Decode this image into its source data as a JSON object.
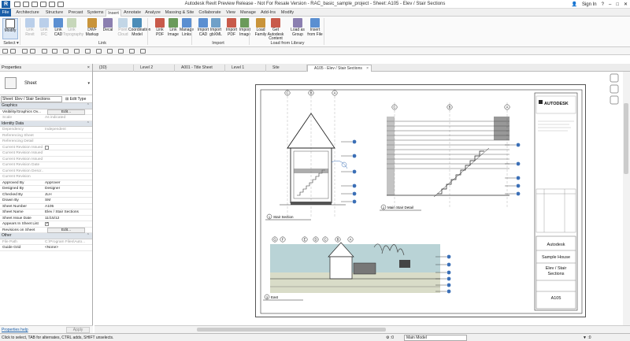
{
  "window": {
    "title": "Autodesk Revit Preview Release - Not For Resale Version - RAC_basic_sample_project - Sheet: A105 - Elev / Stair Sections",
    "sign_in": "Sign In",
    "help": "?"
  },
  "ribbon_tabs": [
    "File",
    "Architecture",
    "Structure",
    "Precast",
    "Systems",
    "Insert",
    "Annotate",
    "Analyze",
    "Massing & Site",
    "Collaborate",
    "View",
    "Manage",
    "Add-Ins",
    "Modify"
  ],
  "ribbon": {
    "modify": {
      "label": "Modify",
      "select": "Select ▾"
    },
    "buttons": [
      {
        "label": "Link\nRevit"
      },
      {
        "label": "Link\nIFC"
      },
      {
        "label": "Link\nCAD"
      },
      {
        "label": "Link\nTopography"
      },
      {
        "label": "DWF\nMarkup"
      },
      {
        "label": "Decal"
      },
      {
        "label": "Point\nCloud"
      },
      {
        "label": "Coordination\nModel"
      },
      {
        "label": "Link\nPDF"
      },
      {
        "label": "Link\nImage"
      },
      {
        "label": "Manage\nLinks"
      },
      {
        "label": "Import\nCAD"
      },
      {
        "label": "Import\ngbXML"
      },
      {
        "label": "Import\nPDF"
      },
      {
        "label": "Import\nImage"
      },
      {
        "label": "Load\nFamily"
      },
      {
        "label": "Get Autodesk\nContent"
      },
      {
        "label": "Load as\nGroup"
      },
      {
        "label": "Insert\nfrom File"
      }
    ],
    "groups": {
      "link": "Link",
      "import": "Import",
      "load": "Load from Library"
    }
  },
  "view_tabs": [
    {
      "label": "{3D}"
    },
    {
      "label": "Level 2"
    },
    {
      "label": "A001 - Title Sheet"
    },
    {
      "label": "Level 1"
    },
    {
      "label": "Site"
    },
    {
      "label": "A105 - Elev / Stair Sections",
      "active": true
    }
  ],
  "properties": {
    "header": "Properties",
    "close": "×",
    "type_name": "Sheet",
    "selector": "Sheet: Elev / Stair Sections",
    "edit_type": "Edit Type",
    "groups": {
      "graphics": "Graphics",
      "identity": "Identity Data",
      "other": "Other"
    },
    "rows_graphics": [
      {
        "k": "Visibility/Graphics Ov...",
        "btn": "Edit..."
      },
      {
        "k": "Scale",
        "v": "As indicated",
        "ro": true
      }
    ],
    "rows_identity": [
      {
        "k": "Dependency",
        "v": "Independent",
        "ro": true
      },
      {
        "k": "Referencing Sheet",
        "v": "",
        "ro": true
      },
      {
        "k": "Referencing Detail",
        "v": "",
        "ro": true
      },
      {
        "k": "Current Revision Issued",
        "v": "",
        "ro": true,
        "cb": true
      },
      {
        "k": "Current Revision Issued By",
        "v": "",
        "ro": true
      },
      {
        "k": "Current Revision Issued To",
        "v": "",
        "ro": true
      },
      {
        "k": "Current Revision Date",
        "v": "",
        "ro": true
      },
      {
        "k": "Current Revision Descr...",
        "v": "",
        "ro": true
      },
      {
        "k": "Current Revision",
        "v": "",
        "ro": true
      },
      {
        "k": "Approved By",
        "v": "Approver"
      },
      {
        "k": "Designed By",
        "v": "Designer"
      },
      {
        "k": "Checked By",
        "v": "JLH"
      },
      {
        "k": "Drawn By",
        "v": "SM"
      },
      {
        "k": "Sheet Number",
        "v": "A105"
      },
      {
        "k": "Sheet Name",
        "v": "Elev / Stair Sections"
      },
      {
        "k": "Sheet Issue Date",
        "v": "11/15/12"
      },
      {
        "k": "Appears In Sheet List",
        "v": "",
        "cb": true
      },
      {
        "k": "Revisions on Sheet",
        "btn": "Edit..."
      }
    ],
    "rows_other": [
      {
        "k": "File Path",
        "v": "C:\\Program Files\\Auto...",
        "ro": true
      },
      {
        "k": "Guide Grid",
        "v": "<None>"
      }
    ],
    "help_link": "Properties help",
    "apply": "Apply"
  },
  "sheet": {
    "title_block": {
      "logo": "AUTODESK",
      "owner": "Autodesk",
      "project": "Sample House",
      "sheet_title": "Elev / Stair\nSections",
      "sheet_number": "A105"
    },
    "views": [
      {
        "num": "1",
        "name": "Stair Section"
      },
      {
        "num": "2",
        "name": "Main Stair Detail"
      },
      {
        "num": "3",
        "name": "East"
      }
    ],
    "grid_bubbles_1": [
      "C",
      "B",
      "A"
    ],
    "grid_bubbles_2": [
      "C",
      "B",
      "A"
    ],
    "grid_bubbles_3": [
      "G",
      "F",
      "E",
      "D",
      "C",
      "B",
      "A"
    ]
  },
  "status": {
    "text": "Click to select, TAB for alternates, CTRL adds, SHIFT unselects.",
    "model": "Main Model",
    "zero": ":0"
  },
  "colors": {
    "accent": "#1b5fa8",
    "sky": "#b9d3d6",
    "ground": "#d9dcc8"
  }
}
